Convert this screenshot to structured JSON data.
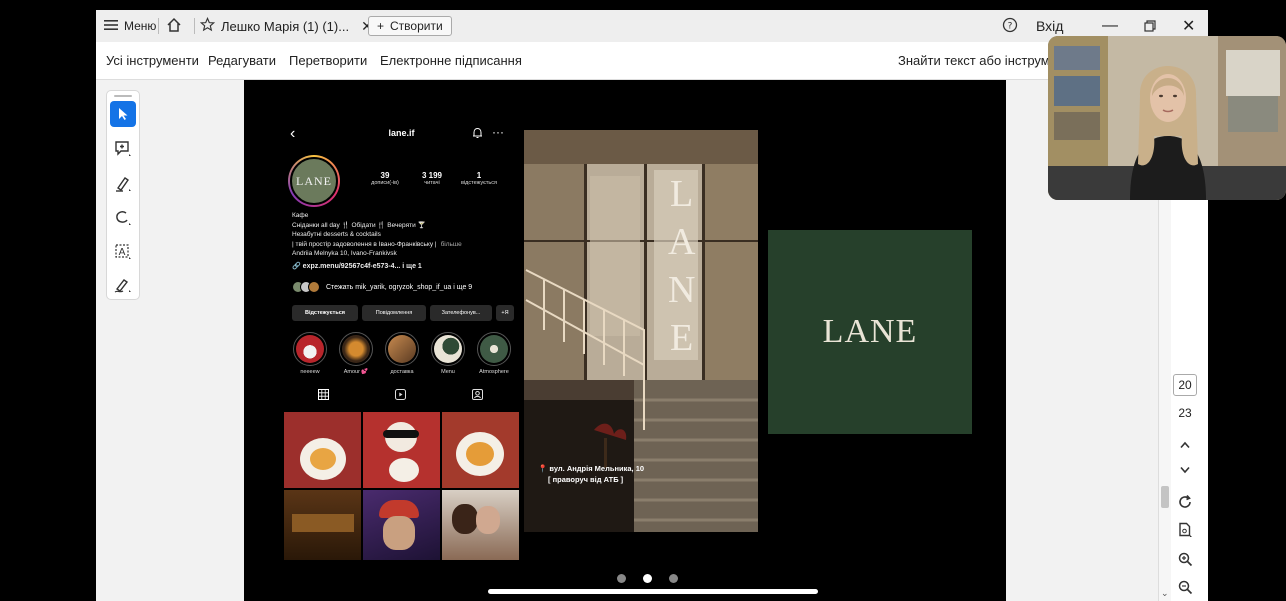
{
  "titlebar": {
    "menu_label": "Меню",
    "tab_title": "Лешко Марія (1) (1)...",
    "create_label": "Створити",
    "signin_label": "Вхід"
  },
  "toolbar": {
    "items": [
      "Усі інструменти",
      "Редагувати",
      "Перетворити",
      "Електронне підписання"
    ],
    "find_label": "Знайти текст або інструмен"
  },
  "left_tools": [
    "select-icon",
    "comment-icon",
    "highlight-pen-icon",
    "draw-icon",
    "text-recognition-icon",
    "signature-icon"
  ],
  "profile": {
    "username": "lane.if",
    "avatar_text": "LANE",
    "stats": [
      {
        "value": "39",
        "label": "дописи(-ів)"
      },
      {
        "value": "3 199",
        "label": "читачі"
      },
      {
        "value": "1",
        "label": "відстежується"
      }
    ],
    "bio": {
      "category": "Кафе",
      "line1": "Сніданки all day 🍴 Обідати 🍴 Вечеряти 🍸",
      "line2": "Незабутні desserts & cocktails",
      "line3": "| твій простір задоволення в Івано-Франківську |",
      "more": "більше",
      "line4": "Andriia Melnyka 10, Ivano-Frankivsk",
      "link": "expz.menu/92567c4f-e573-4... і ще 1"
    },
    "followed_by": "Стежать mik_yarik, ogryzok_shop_if_ua і ще 9",
    "buttons": [
      "Відстежується",
      "Повідомлення",
      "Зателефонув...",
      "+Я"
    ],
    "highlights": [
      "neeeew",
      "Amour 💕",
      "доставка",
      "Menu",
      "Atmosphere"
    ]
  },
  "photo": {
    "sign_letters": [
      "L",
      "A",
      "N",
      "E"
    ],
    "address_line1": "📍 вул. Андрія Мельника, 10",
    "address_line2": "[ праворуч від АТБ ]"
  },
  "green_card": {
    "logo": "LANE"
  },
  "carousel": {
    "dots": 3,
    "active": 1
  },
  "navigation": {
    "current_page": "20",
    "total_pages": "23"
  }
}
